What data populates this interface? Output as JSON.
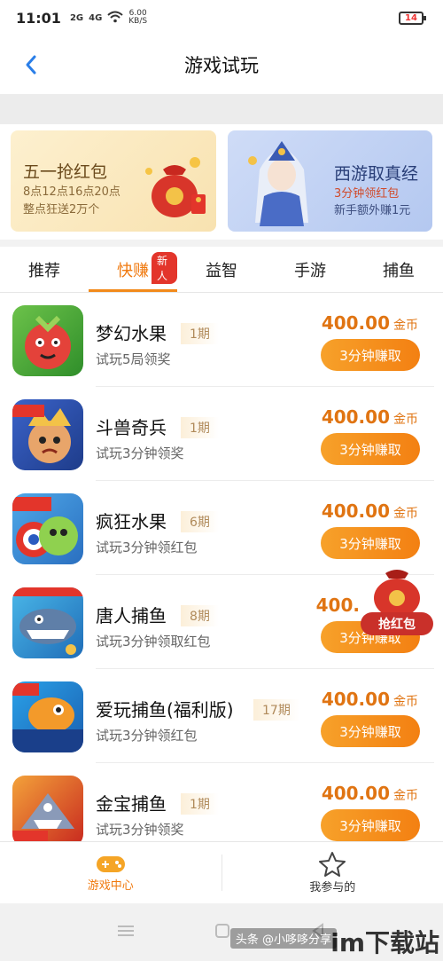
{
  "status": {
    "time": "11:01",
    "signal1": "2G",
    "signal2": "4G",
    "speed_value": "6.00",
    "speed_unit": "KB/S",
    "battery": "14"
  },
  "header": {
    "title": "游戏试玩"
  },
  "banners": [
    {
      "title": "五一抢红包",
      "line1": "8点12点16点20点",
      "line2": "整点狂送2万个"
    },
    {
      "title": "西游取真经",
      "line1": "3分钟领红包",
      "line2": "新手额外赚1元"
    }
  ],
  "tabs": [
    {
      "label": "推荐"
    },
    {
      "label": "快赚",
      "badge": "新人",
      "active": true
    },
    {
      "label": "益智"
    },
    {
      "label": "手游"
    },
    {
      "label": "捕鱼"
    }
  ],
  "games": [
    {
      "name": "梦幻水果",
      "period": "1期",
      "desc": "试玩5局领奖",
      "amount": "400.00",
      "unit": "金币",
      "button": "3分钟赚取"
    },
    {
      "name": "斗兽奇兵",
      "period": "1期",
      "desc": "试玩3分钟领奖",
      "amount": "400.00",
      "unit": "金币",
      "button": "3分钟赚取"
    },
    {
      "name": "疯狂水果",
      "period": "6期",
      "desc": "试玩3分钟领红包",
      "amount": "400.00",
      "unit": "金币",
      "button": "3分钟赚取"
    },
    {
      "name": "唐人捕鱼",
      "period": "8期",
      "desc": "试玩3分钟领取红包",
      "amount": "400.",
      "unit": "",
      "button": "3分钟赚取"
    },
    {
      "name": "爱玩捕鱼(福利版)",
      "period": "17期",
      "desc": "试玩3分钟领红包",
      "amount": "400.00",
      "unit": "金币",
      "button": "3分钟赚取"
    },
    {
      "name": "金宝捕鱼",
      "period": "1期",
      "desc": "试玩3分钟领奖",
      "amount": "400.00",
      "unit": "金币",
      "button": "3分钟赚取"
    }
  ],
  "float_button": {
    "label": "抢红包"
  },
  "bottom_nav": [
    {
      "label": "游戏中心",
      "active": true
    },
    {
      "label": "我参与的"
    }
  ],
  "watermark": {
    "small": "头条 @小哆哆分享",
    "big": "im下载站"
  },
  "colors": {
    "accent": "#f28a1a",
    "badge": "#e3352b"
  }
}
